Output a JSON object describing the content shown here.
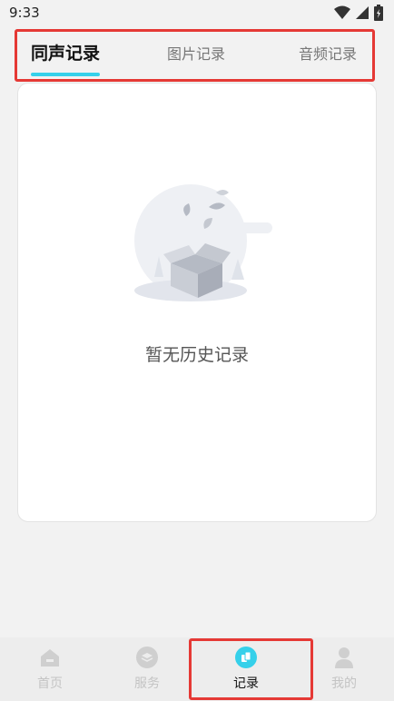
{
  "status": {
    "time": "9:33"
  },
  "tabs": [
    {
      "label": "同声记录",
      "active": true
    },
    {
      "label": "图片记录",
      "active": false
    },
    {
      "label": "音频记录",
      "active": false
    }
  ],
  "empty_state": {
    "message": "暂无历史记录",
    "icon": "empty-box-icon"
  },
  "bottom_nav": [
    {
      "label": "首页",
      "icon": "home-icon",
      "active": false
    },
    {
      "label": "服务",
      "icon": "layers-icon",
      "active": false
    },
    {
      "label": "记录",
      "icon": "record-icon",
      "active": true
    },
    {
      "label": "我的",
      "icon": "user-icon",
      "active": false
    }
  ],
  "colors": {
    "accent": "#35d0ea",
    "highlight": "#e53935",
    "background": "#f2f2f2"
  }
}
